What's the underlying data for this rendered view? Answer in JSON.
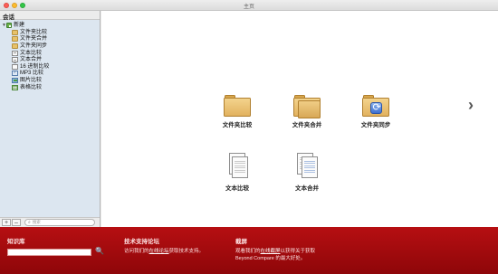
{
  "window": {
    "title": "主页"
  },
  "sidebar": {
    "header": "会话",
    "root_label": "新建",
    "items": [
      {
        "label": "文件夹比较",
        "icon": "folder-compare-icon"
      },
      {
        "label": "文件夹合并",
        "icon": "folder-merge-icon"
      },
      {
        "label": "文件夹同步",
        "icon": "folder-sync-icon"
      },
      {
        "label": "文本比较",
        "icon": "text-compare-icon"
      },
      {
        "label": "文本合并",
        "icon": "text-merge-icon"
      },
      {
        "label": "16 进制比较",
        "icon": "hex-compare-icon"
      },
      {
        "label": "MP3 比较",
        "icon": "mp3-compare-icon"
      },
      {
        "label": "图片比较",
        "icon": "picture-compare-icon"
      },
      {
        "label": "表格比较",
        "icon": "table-compare-icon"
      }
    ],
    "footer": {
      "add": "+",
      "remove": "–",
      "search_placeholder": "搜索"
    }
  },
  "main": {
    "tiles": [
      {
        "label": "文件夹比较",
        "icon": "folder-icon"
      },
      {
        "label": "文件夹合并",
        "icon": "folder-merge-icon"
      },
      {
        "label": "文件夹同步",
        "icon": "folder-sync-icon"
      },
      {
        "label": "文本比较",
        "icon": "document-icon"
      },
      {
        "label": "文本合并",
        "icon": "document-merge-icon"
      }
    ],
    "next_arrow": "›"
  },
  "footer": {
    "knowledge": {
      "title": "知识库",
      "search_icon": "🔍"
    },
    "support": {
      "title": "技术支持论坛",
      "text_before": "访问我们的",
      "link": "在线论坛",
      "text_after": "获取技术支持。"
    },
    "watch": {
      "title": "截屏",
      "text_before": "观看我们的",
      "link": "在线截屏",
      "text_after": "以获得关于获取",
      "line2": "Beyond Compare 的最大好处。"
    }
  },
  "colors": {
    "footer_red": "#a80b0e",
    "sidebar_bg": "#dce6f0",
    "folder": "#e7c169"
  }
}
